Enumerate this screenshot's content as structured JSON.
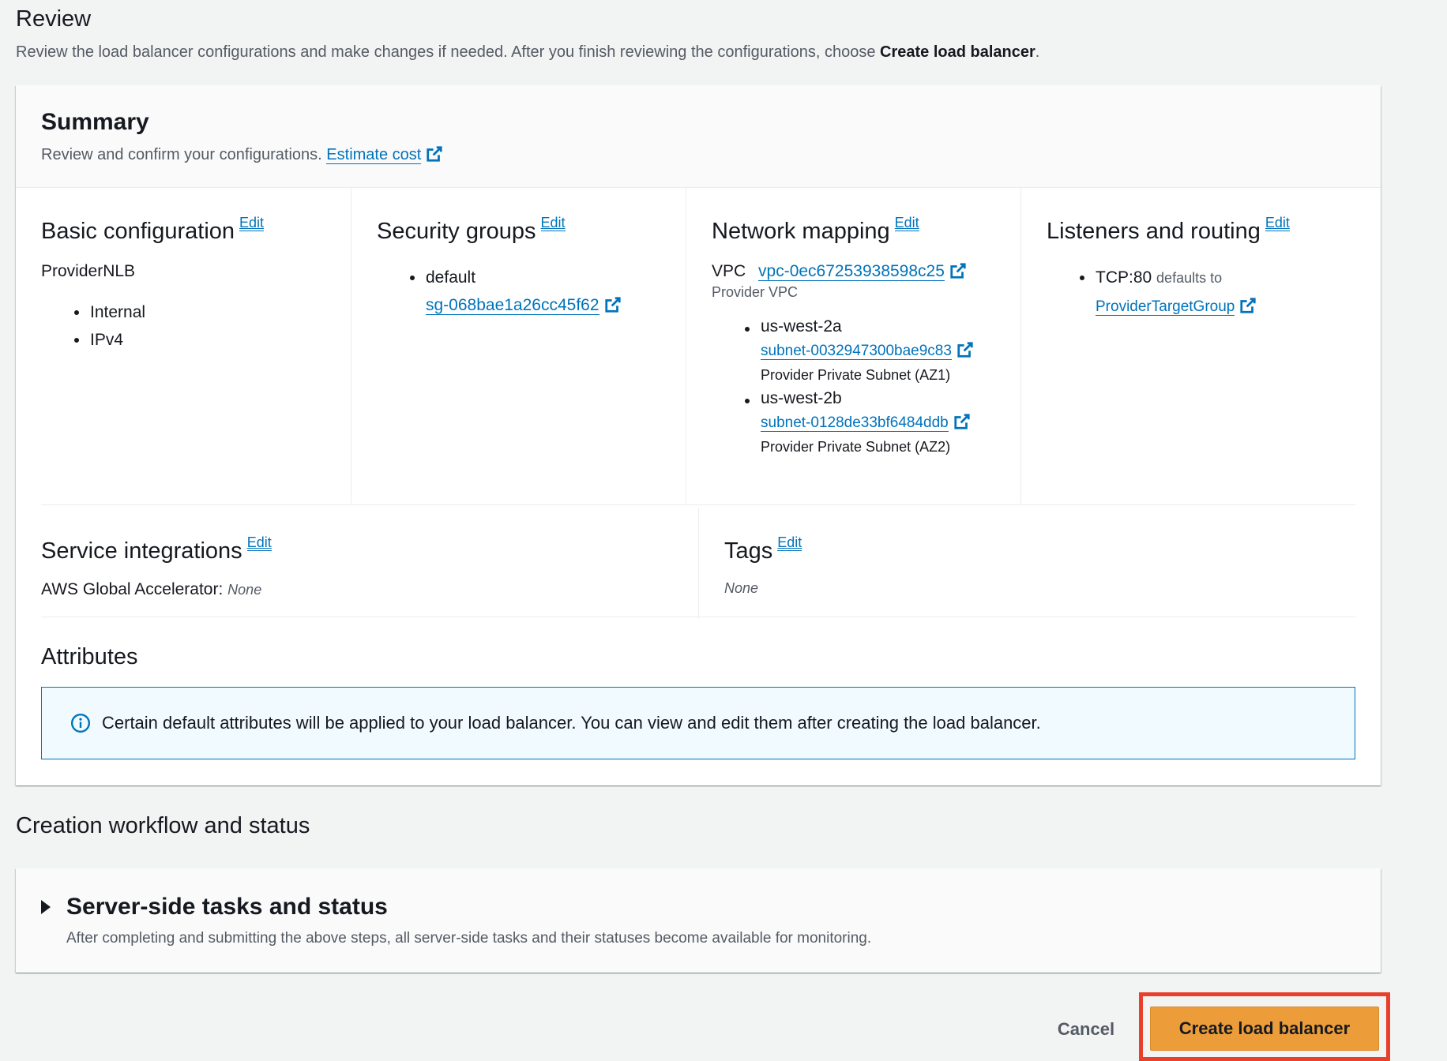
{
  "review": {
    "title": "Review",
    "description_prefix": "Review the load balancer configurations and make changes if needed. After you finish reviewing the configurations, choose ",
    "description_bold": "Create load balancer",
    "description_suffix": "."
  },
  "summary": {
    "title": "Summary",
    "subtitle": "Review and confirm your configurations.",
    "estimate_cost_link": "Estimate cost"
  },
  "edit_label": "Edit",
  "basic_configuration": {
    "title": "Basic configuration",
    "name": "ProviderNLB",
    "items": [
      "Internal",
      "IPv4"
    ]
  },
  "security_groups": {
    "title": "Security groups",
    "group_name": "default",
    "group_id": "sg-068bae1a26cc45f62"
  },
  "network_mapping": {
    "title": "Network mapping",
    "vpc_label": "VPC",
    "vpc_id": "vpc-0ec67253938598c25",
    "vpc_name": "Provider VPC",
    "zones": [
      {
        "zone": "us-west-2a",
        "subnet_id": "subnet-0032947300bae9c83",
        "subnet_name": "Provider Private Subnet (AZ1)"
      },
      {
        "zone": "us-west-2b",
        "subnet_id": "subnet-0128de33bf6484ddb",
        "subnet_name": "Provider Private Subnet (AZ2)"
      }
    ]
  },
  "listeners": {
    "title": "Listeners and routing",
    "listener": "TCP:80",
    "defaults_to": "defaults to",
    "target_group": "ProviderTargetGroup"
  },
  "service_integrations": {
    "title": "Service integrations",
    "label": "AWS Global Accelerator:",
    "value": "None"
  },
  "tags": {
    "title": "Tags",
    "value": "None"
  },
  "attributes": {
    "title": "Attributes",
    "info": "Certain default attributes will be applied to your load balancer. You can view and edit them after creating the load balancer."
  },
  "workflow": {
    "title": "Creation workflow and status",
    "tasks_title": "Server-side tasks and status",
    "tasks_subtitle": "After completing and submitting the above steps, all server-side tasks and their statuses become available for monitoring."
  },
  "footer": {
    "cancel_label": "Cancel",
    "create_label": "Create load balancer"
  },
  "colors": {
    "link": "#0073bb",
    "primary_button": "#ec9d3a",
    "highlight": "#e8402a",
    "info_background": "#f1faff"
  }
}
